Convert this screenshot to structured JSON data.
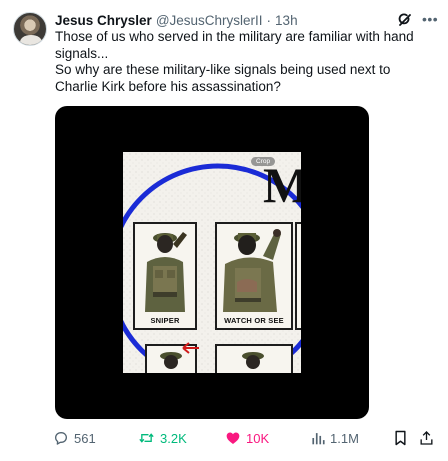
{
  "author": {
    "name": "Jesus Chrysler",
    "handle": "@JesusChryslerII",
    "separator": "·",
    "time": "13h"
  },
  "tweet": {
    "line1": "Those of us who served in the military are familiar with hand signals...",
    "line2": "So why are these military-like signals being used next to Charlie Kirk before his assassination?"
  },
  "media": {
    "crop_label": "Crop",
    "title_letters": "MI",
    "cards": [
      {
        "label": "SNIPER"
      },
      {
        "label": "WATCH OR SEE"
      }
    ],
    "circle_color": "#1a2bd6"
  },
  "actions": {
    "replies": "561",
    "reposts": "3.2K",
    "likes": "10K",
    "views": "1.1M"
  },
  "colors": {
    "repost": "#00ba7c",
    "like": "#f91880",
    "muted": "#536471"
  },
  "icons": [
    "grok-icon",
    "more-icon",
    "reply-icon",
    "repost-icon",
    "like-icon",
    "views-icon",
    "bookmark-icon",
    "share-icon"
  ]
}
